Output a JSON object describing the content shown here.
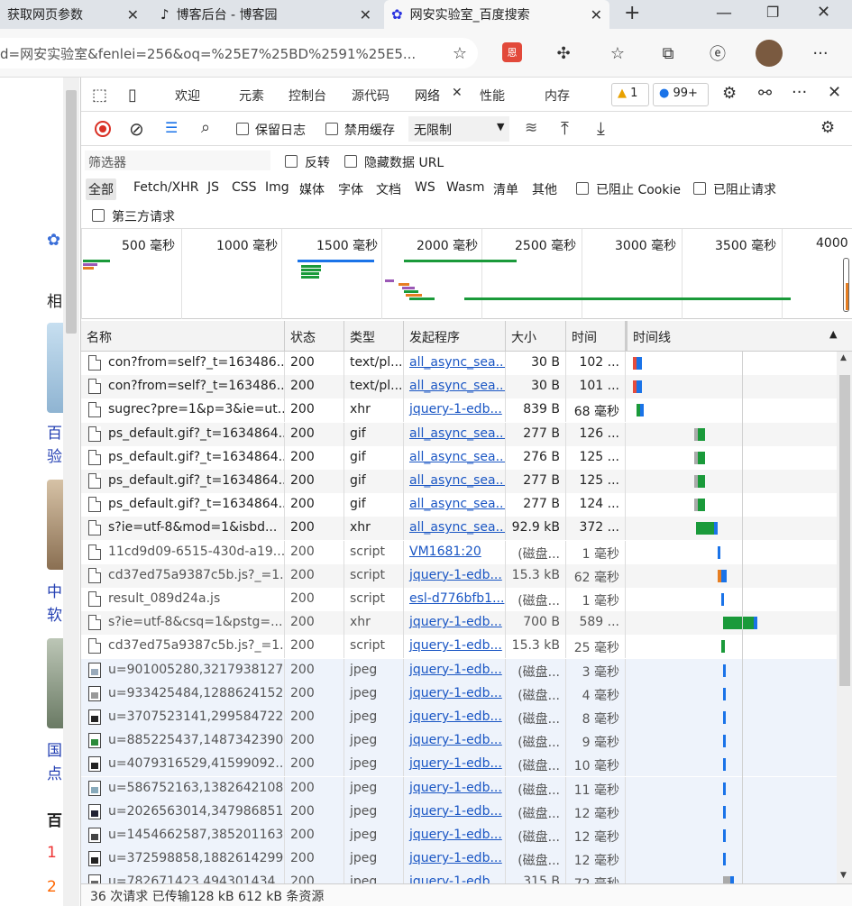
{
  "browser": {
    "tabs": [
      {
        "label": "获取网页参数",
        "active": false
      },
      {
        "label": "博客后台 - 博客园",
        "active": false
      },
      {
        "label": "网安实验室_百度搜索",
        "active": true
      }
    ],
    "url": "d=网安实验室&fenlei=256&oq=%25E7%25BD%2591%25E5..."
  },
  "leftpage": {
    "snippets": [
      "相",
      "百",
      "验",
      "中",
      "软",
      "国",
      "点",
      "百",
      "1",
      "2"
    ]
  },
  "devtools": {
    "tabs": [
      "欢迎",
      "元素",
      "控制台",
      "源代码",
      "网络",
      "性能",
      "内存"
    ],
    "active_tab": "网络",
    "warnings": "1",
    "messages": "99+",
    "toolbar": {
      "preserve_log": "保留日志",
      "disable_cache": "禁用缓存",
      "throttle": "无限制"
    },
    "filter": {
      "placeholder": "筛选器",
      "invert": "反转",
      "hide_data_urls": "隐藏数据 URL"
    },
    "types": [
      "全部",
      "Fetch/XHR",
      "JS",
      "CSS",
      "Img",
      "媒体",
      "字体",
      "文档",
      "WS",
      "Wasm",
      "清单",
      "其他"
    ],
    "blocked_cookies": "已阻止 Cookie",
    "blocked_requests": "已阻止请求",
    "third_party": "第三方请求",
    "overview_ticks": [
      "500 毫秒",
      "1000 毫秒",
      "1500 毫秒",
      "2000 毫秒",
      "2500 毫秒",
      "3000 毫秒",
      "3500 毫秒",
      "4000"
    ],
    "columns": [
      "名称",
      "状态",
      "类型",
      "发起程序",
      "大小",
      "时间",
      "时间线"
    ],
    "rows": [
      {
        "name": "con?from=self?_t=163486...",
        "status": "200",
        "type": "text/pl...",
        "initiator": "all_async_sea...",
        "size": "30 B",
        "time": "102 ...",
        "icon": "file"
      },
      {
        "name": "con?from=self?_t=163486...",
        "status": "200",
        "type": "text/pl...",
        "initiator": "all_async_sea...",
        "size": "30 B",
        "time": "101 ...",
        "icon": "file"
      },
      {
        "name": "sugrec?pre=1&p=3&ie=ut...",
        "status": "200",
        "type": "xhr",
        "initiator": "jquery-1-edb...",
        "size": "839 B",
        "time": "68 毫秒",
        "icon": "file"
      },
      {
        "name": "ps_default.gif?_t=1634864...",
        "status": "200",
        "type": "gif",
        "initiator": "all_async_sea...",
        "size": "277 B",
        "time": "126 ...",
        "icon": "file"
      },
      {
        "name": "ps_default.gif?_t=1634864...",
        "status": "200",
        "type": "gif",
        "initiator": "all_async_sea...",
        "size": "276 B",
        "time": "125 ...",
        "icon": "file"
      },
      {
        "name": "ps_default.gif?_t=1634864...",
        "status": "200",
        "type": "gif",
        "initiator": "all_async_sea...",
        "size": "277 B",
        "time": "125 ...",
        "icon": "file"
      },
      {
        "name": "ps_default.gif?_t=1634864...",
        "status": "200",
        "type": "gif",
        "initiator": "all_async_sea...",
        "size": "277 B",
        "time": "124 ...",
        "icon": "file"
      },
      {
        "name": "s?ie=utf-8&mod=1&isbd...",
        "status": "200",
        "type": "xhr",
        "initiator": "all_async_sea...",
        "size": "92.9 kB",
        "time": "372 ...",
        "icon": "file"
      },
      {
        "name": "11cd9d09-6515-430d-a19...",
        "status": "200",
        "type": "script",
        "initiator": "VM1681:20",
        "size": "(磁盘...",
        "time": "1 毫秒",
        "icon": "file"
      },
      {
        "name": "cd37ed75a9387c5b.js?_=1...",
        "status": "200",
        "type": "script",
        "initiator": "jquery-1-edb...",
        "size": "15.3 kB",
        "time": "62 毫秒",
        "icon": "file"
      },
      {
        "name": "result_089d24a.js",
        "status": "200",
        "type": "script",
        "initiator": "esl-d776bfb1...",
        "size": "(磁盘...",
        "time": "1 毫秒",
        "icon": "file"
      },
      {
        "name": "s?ie=utf-8&csq=1&pstg=...",
        "status": "200",
        "type": "xhr",
        "initiator": "jquery-1-edb...",
        "size": "700 B",
        "time": "589 ...",
        "icon": "file"
      },
      {
        "name": "cd37ed75a9387c5b.js?_=1...",
        "status": "200",
        "type": "script",
        "initiator": "jquery-1-edb...",
        "size": "15.3 kB",
        "time": "25 毫秒",
        "icon": "file"
      },
      {
        "name": "u=901005280,3217938127...",
        "status": "200",
        "type": "jpeg",
        "initiator": "jquery-1-edb...",
        "size": "(磁盘...",
        "time": "3 毫秒",
        "icon": "img"
      },
      {
        "name": "u=933425484,1288624152...",
        "status": "200",
        "type": "jpeg",
        "initiator": "jquery-1-edb...",
        "size": "(磁盘...",
        "time": "4 毫秒",
        "icon": "img"
      },
      {
        "name": "u=3707523141,299584722...",
        "status": "200",
        "type": "jpeg",
        "initiator": "jquery-1-edb...",
        "size": "(磁盘...",
        "time": "8 毫秒",
        "icon": "img"
      },
      {
        "name": "u=885225437,1487342390...",
        "status": "200",
        "type": "jpeg",
        "initiator": "jquery-1-edb...",
        "size": "(磁盘...",
        "time": "9 毫秒",
        "icon": "img"
      },
      {
        "name": "u=4079316529,41599092...",
        "status": "200",
        "type": "jpeg",
        "initiator": "jquery-1-edb...",
        "size": "(磁盘...",
        "time": "10 毫秒",
        "icon": "img"
      },
      {
        "name": "u=586752163,1382642108...",
        "status": "200",
        "type": "jpeg",
        "initiator": "jquery-1-edb...",
        "size": "(磁盘...",
        "time": "11 毫秒",
        "icon": "img"
      },
      {
        "name": "u=2026563014,347986851...",
        "status": "200",
        "type": "jpeg",
        "initiator": "jquery-1-edb...",
        "size": "(磁盘...",
        "time": "12 毫秒",
        "icon": "img"
      },
      {
        "name": "u=1454662587,385201163...",
        "status": "200",
        "type": "jpeg",
        "initiator": "jquery-1-edb...",
        "size": "(磁盘...",
        "time": "12 毫秒",
        "icon": "img"
      },
      {
        "name": "u=372598858,1882614299...",
        "status": "200",
        "type": "jpeg",
        "initiator": "jquery-1-edb...",
        "size": "(磁盘...",
        "time": "12 毫秒",
        "icon": "img"
      },
      {
        "name": "u=782671423,494301434...",
        "status": "200",
        "type": "jpeg",
        "initiator": "jquery-1-edb...",
        "size": "315 B",
        "time": "72 毫秒",
        "icon": "img"
      }
    ],
    "status_bar": "36 次请求 已传输128 kB 612 kB 条资源"
  }
}
